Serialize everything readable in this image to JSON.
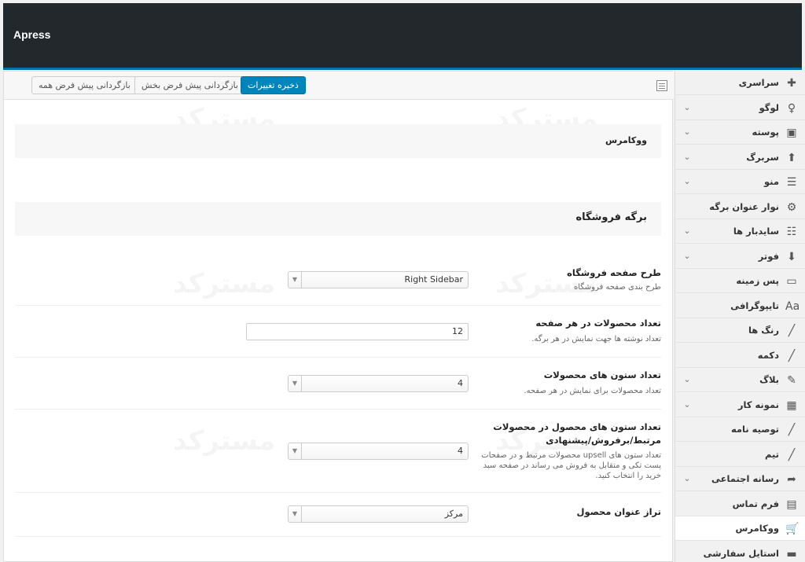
{
  "app": {
    "title": "Apress"
  },
  "toolbar": {
    "save_label": "ذخیره تغییرات",
    "reset_section_label": "بازگردانی پیش فرض بخش",
    "reset_all_label": "بازگردانی پیش فرض همه"
  },
  "sidebar": {
    "items": [
      {
        "label": "سراسری",
        "icon": "puzzle-icon",
        "glyph": "✚",
        "chevron": false
      },
      {
        "label": "لوگو",
        "icon": "lightbulb-icon",
        "glyph": "♀",
        "chevron": true
      },
      {
        "label": "پوسته",
        "icon": "layout-icon",
        "glyph": "▣",
        "chevron": true
      },
      {
        "label": "سربرگ",
        "icon": "arrow-up-icon",
        "glyph": "⬆",
        "chevron": true
      },
      {
        "label": "منو",
        "icon": "menu-icon",
        "glyph": "☰",
        "chevron": true
      },
      {
        "label": "نوار عنوان برگه",
        "icon": "gear-icon",
        "glyph": "⚙",
        "chevron": false
      },
      {
        "label": "سایدبار ها",
        "icon": "list-icon",
        "glyph": "☷",
        "chevron": true
      },
      {
        "label": "فوتر",
        "icon": "arrow-down-icon",
        "glyph": "⬇",
        "chevron": true
      },
      {
        "label": "پس زمینه",
        "icon": "monitor-icon",
        "glyph": "▭",
        "chevron": false
      },
      {
        "label": "تایپوگرافی",
        "icon": "typography-icon",
        "glyph": "Aa",
        "chevron": false
      },
      {
        "label": "رنگ ها",
        "icon": "brush-icon",
        "glyph": "╱",
        "chevron": false
      },
      {
        "label": "دکمه",
        "icon": "brush-icon",
        "glyph": "╱",
        "chevron": false
      },
      {
        "label": "بلاگ",
        "icon": "edit-icon",
        "glyph": "✎",
        "chevron": true
      },
      {
        "label": "نمونه کار",
        "icon": "grid-icon",
        "glyph": "▦",
        "chevron": true
      },
      {
        "label": "توصیه نامه",
        "icon": "brush-icon",
        "glyph": "╱",
        "chevron": false
      },
      {
        "label": "تیم",
        "icon": "brush-icon",
        "glyph": "╱",
        "chevron": false
      },
      {
        "label": "رسانه اجتماعی",
        "icon": "share-icon",
        "glyph": "➦",
        "chevron": true
      },
      {
        "label": "فرم تماس",
        "icon": "contact-icon",
        "glyph": "▤",
        "chevron": false
      },
      {
        "label": "ووکامرس",
        "icon": "cart-icon",
        "glyph": "🛒",
        "chevron": false,
        "active": true
      },
      {
        "label": "استایل سفارشی",
        "icon": "css-icon",
        "glyph": "▬",
        "chevron": false
      }
    ]
  },
  "sections": {
    "woocommerce": "ووکامرس",
    "shop_page": "برگه فروشگاه"
  },
  "fields": {
    "shop_layout": {
      "title": "طرح صفحه فروشگاه",
      "desc": "طرح بندی صفحه فروشگاه",
      "value": "Right Sidebar"
    },
    "products_per_page": {
      "title": "تعداد محصولات در هر صفحه",
      "desc": "تعداد نوشته ها جهت نمایش در هر برگه.",
      "value": "12"
    },
    "product_columns": {
      "title": "تعداد ستون های محصولات",
      "desc": "تعداد محصولات برای نمایش در هر صفحه.",
      "value": "4"
    },
    "related_columns": {
      "title": "تعداد ستون های محصول در محصولات مرتبط/برفروش/پیشنهادی",
      "desc": "تعداد ستون های upsell محصولات مرتبط و در صفحات پست تکی و متقابل به فروش می رساند در صفحه سبد خرید را انتخاب کنید.",
      "value": "4"
    },
    "title_align": {
      "title": "تراز عنوان محصول",
      "value": "مرکز"
    }
  },
  "watermark": "مسترکد"
}
